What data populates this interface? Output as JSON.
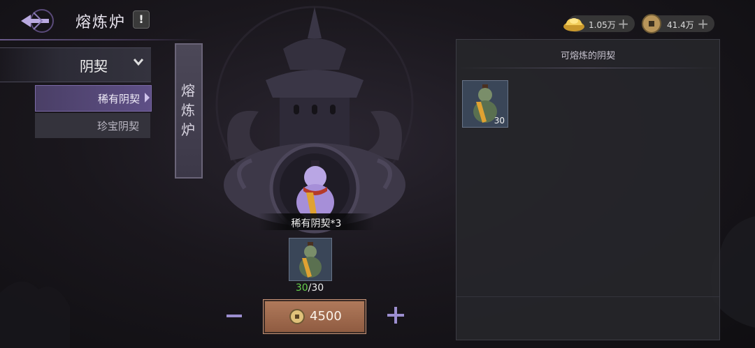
{
  "header": {
    "title": "熔炼炉",
    "info_label": "!"
  },
  "currencies": [
    {
      "icon": "gold-ingot-icon",
      "amount": "1.05万"
    },
    {
      "icon": "copper-coin-icon",
      "amount": "41.4万"
    }
  ],
  "category": {
    "dropdown_label": "阴契",
    "items": [
      {
        "label": "稀有阴契",
        "selected": true
      },
      {
        "label": "珍宝阴契",
        "selected": false
      }
    ]
  },
  "banner": {
    "text": "熔炼炉"
  },
  "product": {
    "label": "稀有阴契*3"
  },
  "slot": {
    "current": "30",
    "separator": "/",
    "required": "30"
  },
  "smelt": {
    "cost": "4500",
    "minus": "−",
    "plus": "+"
  },
  "right_panel": {
    "title": "可熔炼的阴契",
    "items": [
      {
        "icon": "green-gourd-icon",
        "quantity": "30"
      }
    ]
  },
  "colors": {
    "accent_purple": "#5e4f86",
    "count_green": "#67d14c",
    "smelt_button": "#a46f52"
  }
}
